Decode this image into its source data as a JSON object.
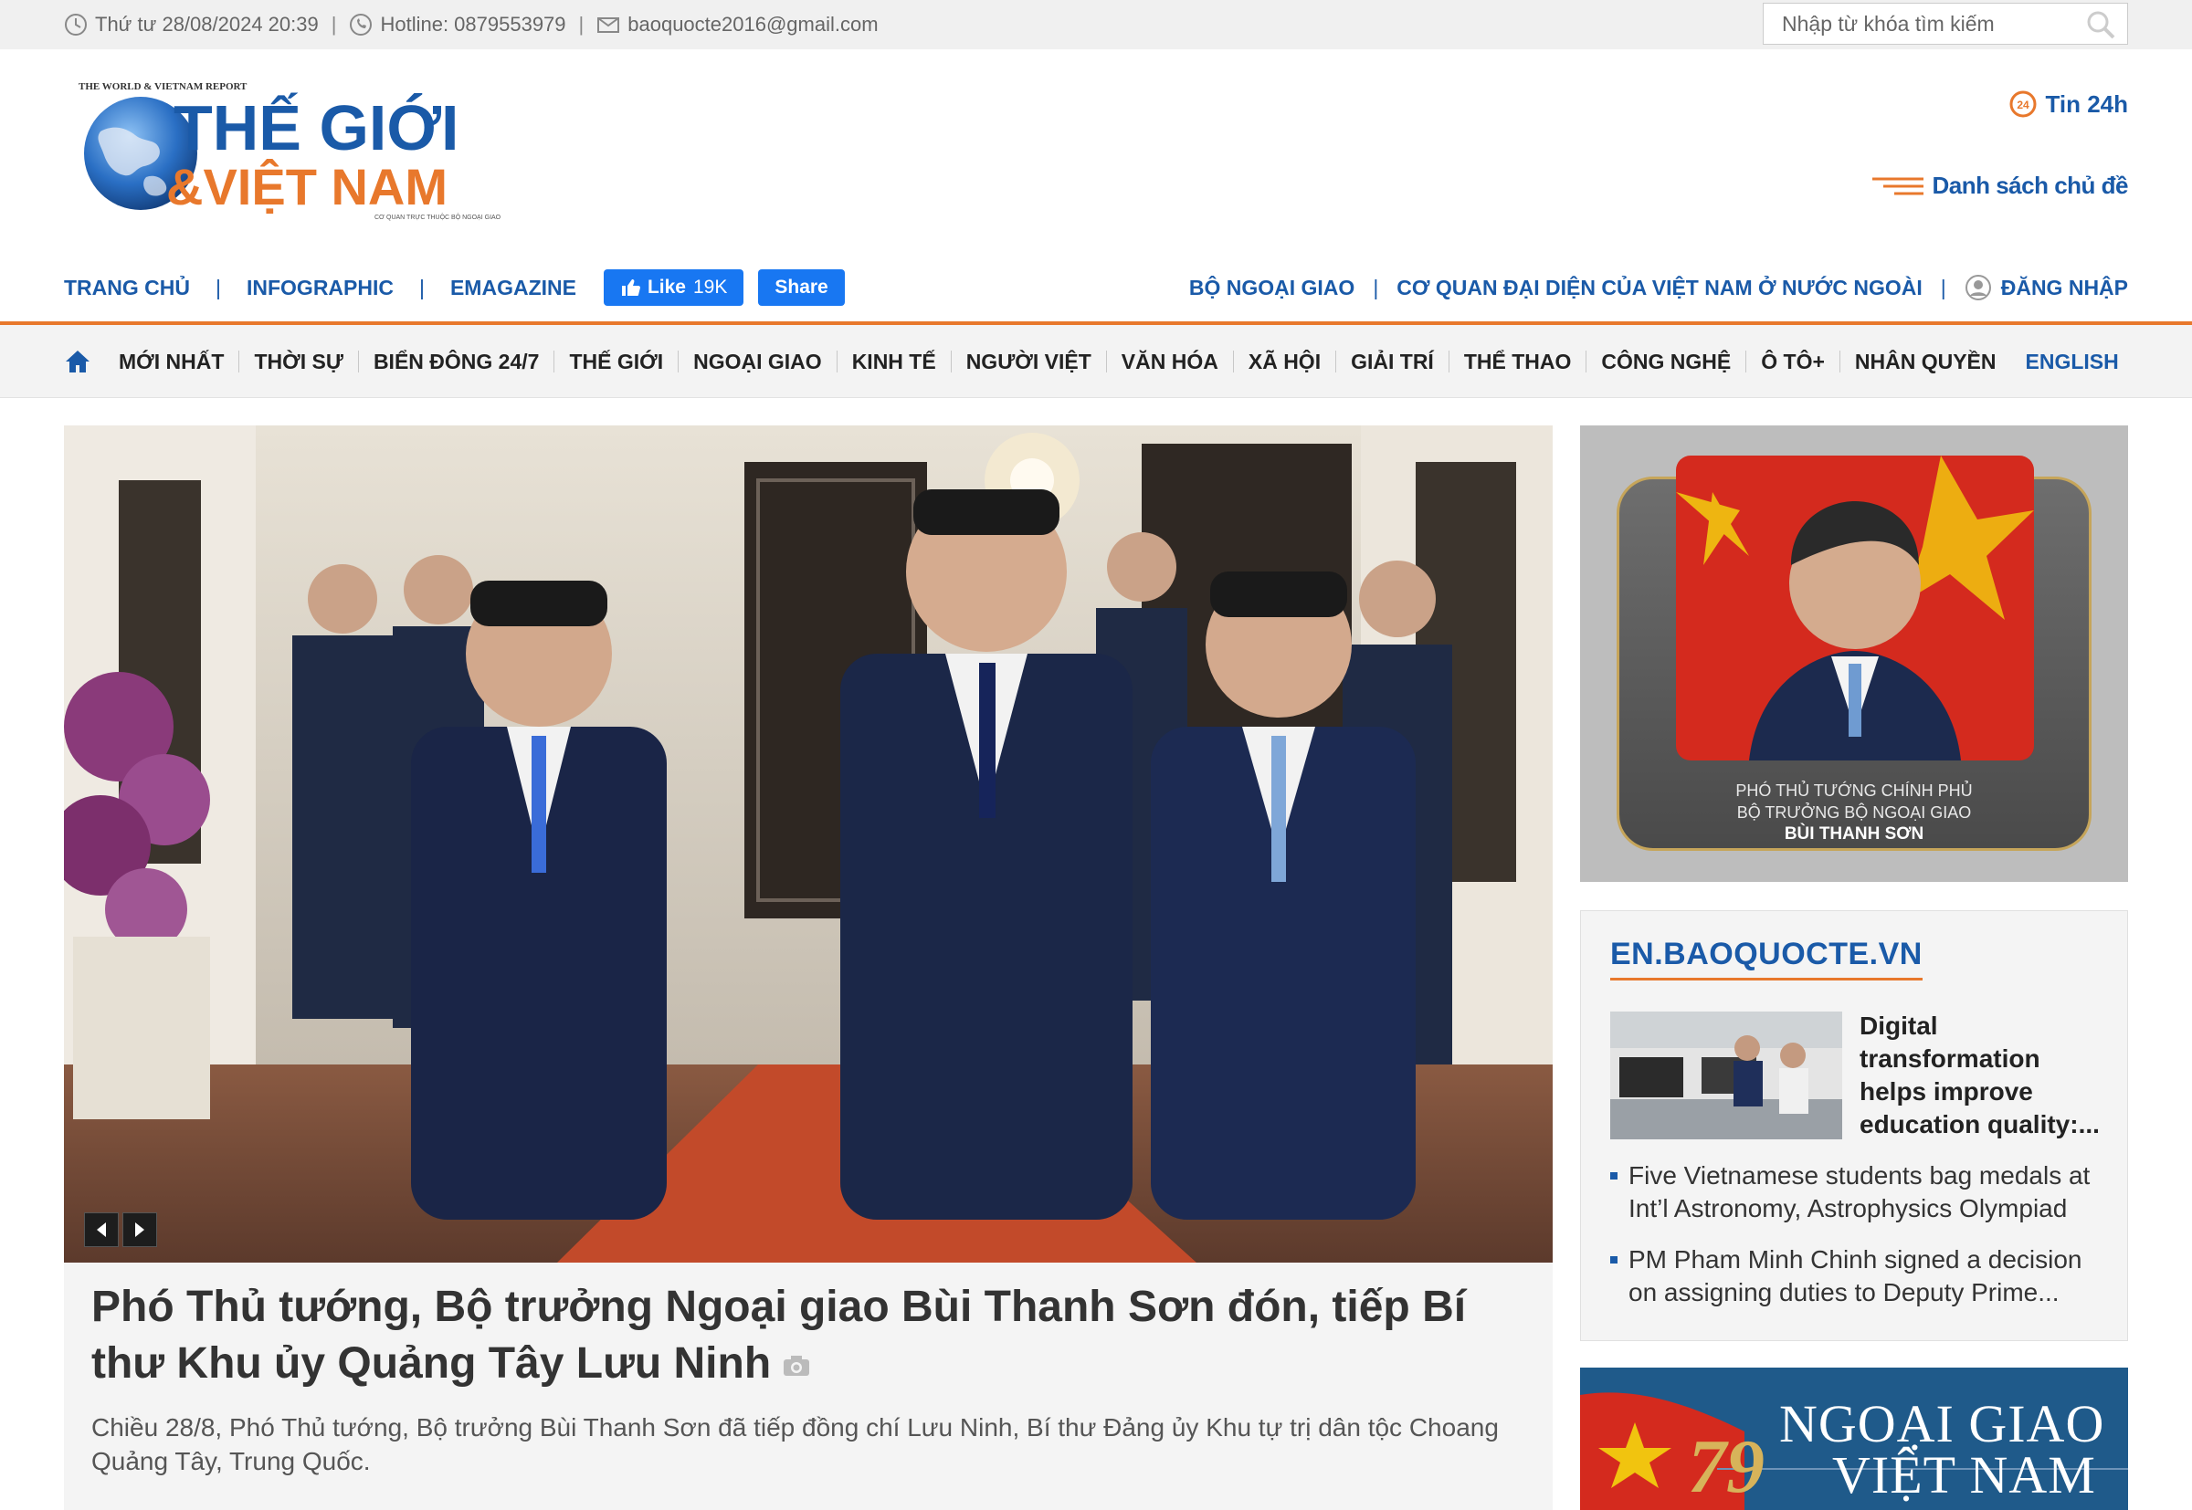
{
  "topbar": {
    "datetime": "Thứ tư 28/08/2024 20:39",
    "hotline": "Hotline: 0879553979",
    "email": "baoquocte2016@gmail.com",
    "search_placeholder": "Nhập từ khóa tìm kiếm"
  },
  "logo": {
    "tagline": "THE WORLD & VIETNAM REPORT",
    "line1": "THẾ GIỚI",
    "line2": "&VIỆT NAM",
    "subline": "CƠ QUAN TRỰC THUỘC BỘ NGOẠI GIAO"
  },
  "header": {
    "tin24": "Tin 24h",
    "topics": "Danh sách chủ đề"
  },
  "secondary_nav": {
    "left": [
      "TRANG CHỦ",
      "INFOGRAPHIC",
      "EMAGAZINE"
    ],
    "fb_like": "Like",
    "fb_like_count": "19K",
    "fb_share": "Share",
    "right": [
      "BỘ NGOẠI GIAO",
      "CƠ QUAN ĐẠI DIỆN CỦA VIỆT NAM Ở NƯỚC NGOÀI"
    ],
    "login": "ĐĂNG NHẬP"
  },
  "main_nav": {
    "items": [
      "MỚI NHẤT",
      "THỜI SỰ",
      "BIỂN ĐÔNG 24/7",
      "THẾ GIỚI",
      "NGOẠI GIAO",
      "KINH TẾ",
      "NGƯỜI VIỆT",
      "VĂN HÓA",
      "XÃ HỘI",
      "GIẢI TRÍ",
      "THỂ THAO",
      "CÔNG NGHỆ",
      "Ô TÔ+",
      "NHÂN QUYỀN"
    ],
    "english": "ENGLISH"
  },
  "hero": {
    "title": "Phó Thủ tướng, Bộ trưởng Ngoại giao Bùi Thanh Sơn đón, tiếp Bí thư Khu ủy Quảng Tây Lưu Ninh",
    "sapo": "Chiều 28/8, Phó Thủ tướng, Bộ trưởng Bùi Thanh Sơn đã tiếp đồng chí Lưu Ninh, Bí thư Đảng ủy Khu tự trị dân tộc Choang Quảng Tây, Trung Quốc."
  },
  "promo": {
    "line1": "PHÓ THỦ TƯỚNG CHÍNH PHỦ",
    "line2": "BỘ TRƯỞNG BỘ NGOẠI GIAO",
    "line3": "BÙI THANH SƠN"
  },
  "en_box": {
    "heading": "EN.BAOQUOCTE.VN",
    "featured_title": "Digital transformation helps improve education quality:...",
    "items": [
      "Five Vietnamese students bag medals at Int’l Astronomy, Astrophysics Olympiad",
      "PM Pham Minh Chinh signed a decision on assigning duties to Deputy Prime..."
    ]
  },
  "banner": {
    "line1": "NGOẠI GIAO",
    "line2": "VIỆT NAM",
    "number": "79"
  },
  "colors": {
    "brand_blue": "#1a5aa8",
    "accent_orange": "#e8782c",
    "facebook_blue": "#1877f2"
  }
}
